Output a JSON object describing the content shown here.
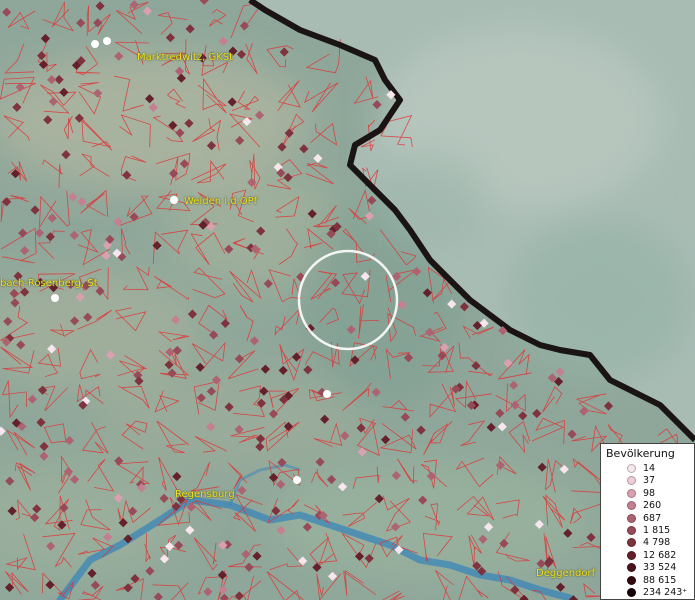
{
  "map": {
    "terrain_color": "#8fa89a",
    "border_color": "#111111",
    "municipal_boundary_color": "#e03434",
    "river_color": "#3a86b8",
    "selection_circle_color": "#ffffff"
  },
  "labels": {
    "marktredwitz": "Marktredwitz, GKSt",
    "weiden": "Weiden i.d.OPf",
    "sulzbach": "bach-Rosenberg, St",
    "regensburg": "Regensburg",
    "deggendorf": "Deggendorf"
  },
  "legend": {
    "title": "Bevölkerung",
    "entries": [
      {
        "label": "14",
        "color": "#f7e6ee"
      },
      {
        "label": "37",
        "color": "#efccd8"
      },
      {
        "label": "98",
        "color": "#d9a0b0"
      },
      {
        "label": "260",
        "color": "#c48090"
      },
      {
        "label": "687",
        "color": "#ad6472"
      },
      {
        "label": "1 815",
        "color": "#974a57"
      },
      {
        "label": "4 798",
        "color": "#7e333e"
      },
      {
        "label": "12 682",
        "color": "#65212b"
      },
      {
        "label": "33 524",
        "color": "#4b131a"
      },
      {
        "label": "88 615",
        "color": "#33090d"
      },
      {
        "label": "234 243⁺",
        "color": "#1a0306"
      }
    ]
  }
}
